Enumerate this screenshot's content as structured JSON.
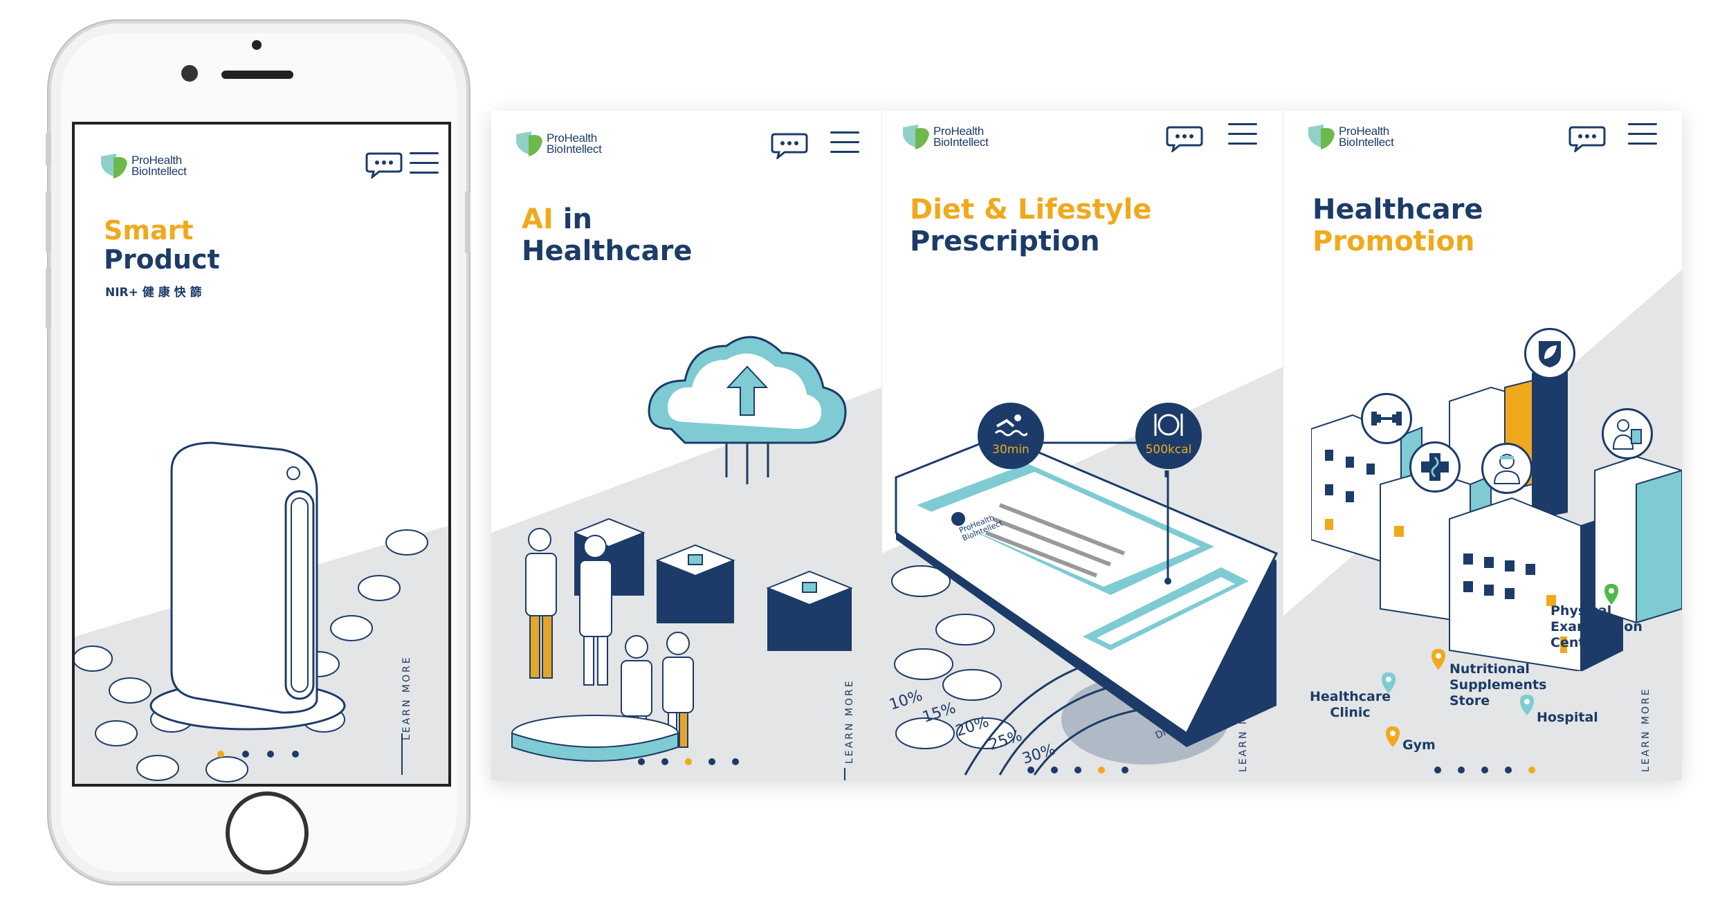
{
  "brand": {
    "line1": "ProHealth",
    "line2": "BioIntellect"
  },
  "learn_more": "LEARN MORE",
  "phone": {
    "title_line1": "Smart",
    "title_line2": "Product",
    "subtitle": "NIR+ 健 康 快 篩",
    "dots": [
      true,
      false,
      false,
      false
    ]
  },
  "panels": [
    {
      "title_part1": "AI",
      "title_part2": " in",
      "title_line2": "Healthcare",
      "active_dot": 3
    },
    {
      "title_line1": "Diet & Lifestyle",
      "title_line2": "Prescription",
      "active_dot": 4,
      "badges": {
        "swim": "30min",
        "food": "500kcal"
      },
      "app_brand_line1": "ProHealth",
      "app_brand_line2": "BioIntellect",
      "percentages": [
        "10%",
        "15%",
        "20%",
        "25%",
        "30%"
      ],
      "diet_label": "Diet Management"
    },
    {
      "title_line1": "Healthcare",
      "title_line2": "Promotion",
      "active_dot": 5,
      "places": {
        "physical": "Physical\nExamination\nCenter",
        "nutrition": "Nutritional\nSupplements\nStore",
        "clinic": "Healthcare\nClinic",
        "hospital": "Hospital",
        "gym": "Gym"
      }
    }
  ],
  "colors": {
    "navy": "#1c3b68",
    "gold": "#f0a91d",
    "teal": "#7ecbd3",
    "floor": "#e3e5e6",
    "leaf_teal": "#8fd1c9",
    "leaf_green": "#6fb84c"
  }
}
